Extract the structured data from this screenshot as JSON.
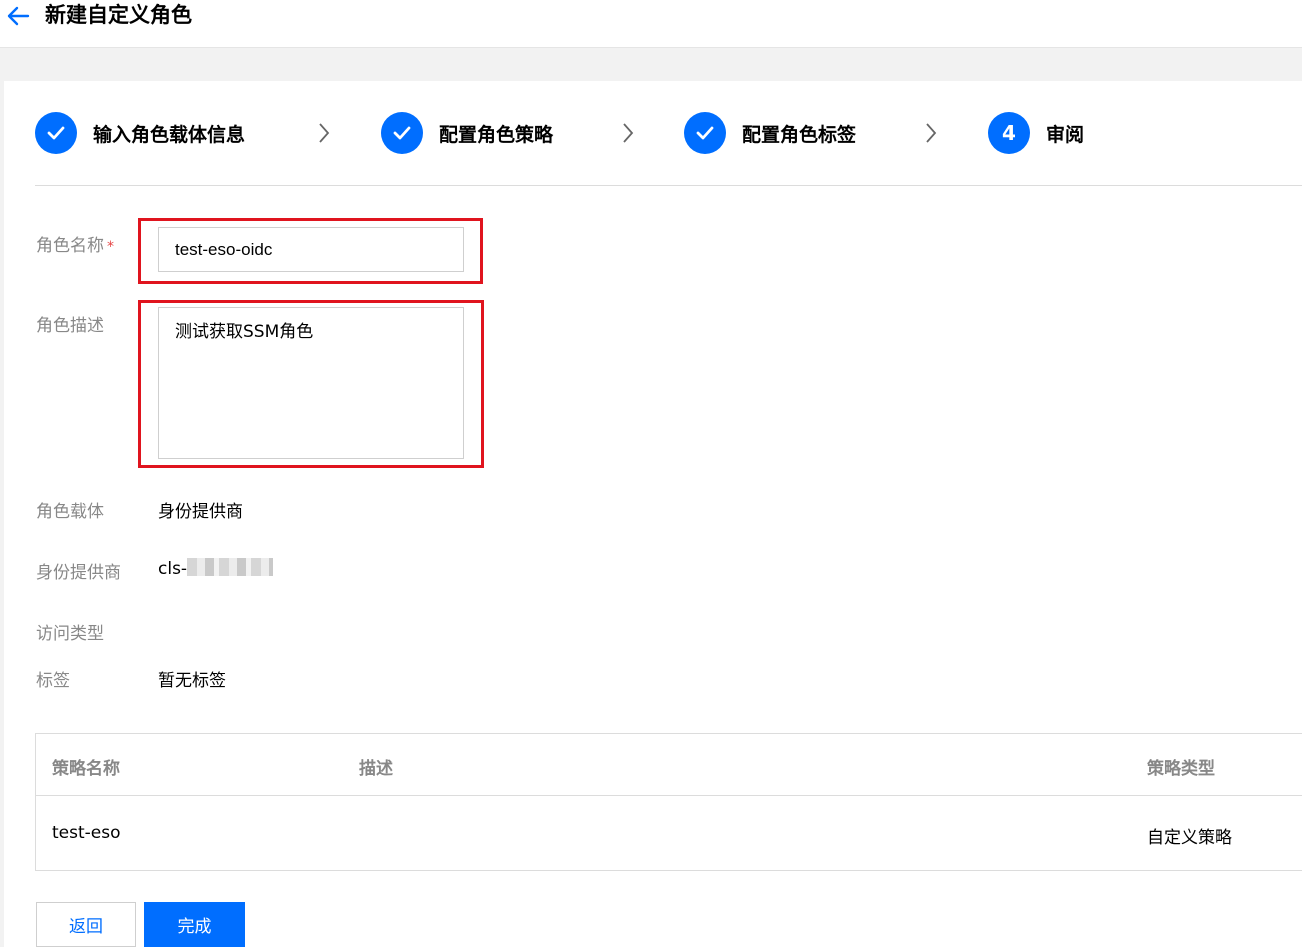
{
  "header": {
    "title": "新建自定义角色"
  },
  "steps": [
    {
      "label": "输入角色载体信息",
      "status": "done"
    },
    {
      "label": "配置角色策略",
      "status": "done"
    },
    {
      "label": "配置角色标签",
      "status": "done"
    },
    {
      "label": "审阅",
      "number": "4",
      "status": "current"
    }
  ],
  "form": {
    "role_name": {
      "label": "角色名称",
      "required_mark": "*",
      "value": "test-eso-oidc"
    },
    "role_desc": {
      "label": "角色描述",
      "value": "测试获取SSM角色"
    },
    "role_carrier": {
      "label": "角色载体",
      "value": "身份提供商"
    },
    "idp": {
      "label": "身份提供商",
      "value_prefix": "cls-"
    },
    "access_type": {
      "label": "访问类型"
    },
    "tags": {
      "label": "标签",
      "value": "暂无标签"
    }
  },
  "table": {
    "columns": [
      "策略名称",
      "描述",
      "策略类型"
    ],
    "rows": [
      {
        "name": "test-eso",
        "desc": "",
        "type": "自定义策略"
      }
    ]
  },
  "actions": {
    "back_label": "返回",
    "finish_label": "完成"
  },
  "colors": {
    "primary": "#006eff",
    "highlight": "#e0141e",
    "required": "#e54545"
  }
}
